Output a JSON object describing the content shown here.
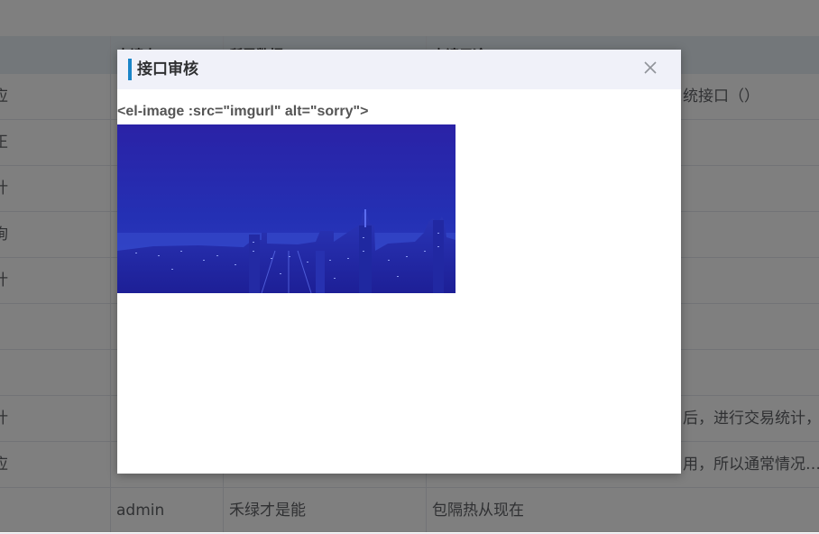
{
  "table": {
    "columns": [
      {
        "label": ""
      },
      {
        "label": "申请人"
      },
      {
        "label": "所需数据"
      },
      {
        "label": "申请用途"
      }
    ],
    "rows": [
      {
        "c0": "应",
        "c1": "",
        "c2": "",
        "c3": "…统接口（）"
      },
      {
        "c0": "正",
        "c1": "",
        "c2": "",
        "c3": ""
      },
      {
        "c0": "计",
        "c1": "",
        "c2": "",
        "c3": ""
      },
      {
        "c0": "询",
        "c1": "",
        "c2": "",
        "c3": ""
      },
      {
        "c0": "计",
        "c1": "",
        "c2": "",
        "c3": ""
      },
      {
        "c0": "",
        "c1": "",
        "c2": "",
        "c3": ""
      },
      {
        "c0": "",
        "c1": "",
        "c2": "",
        "c3": ""
      },
      {
        "c0": "计",
        "c1": "",
        "c2": "",
        "c3": "…后，进行交易统计，…"
      },
      {
        "c0": "应",
        "c1": "",
        "c2": "",
        "c3": "…用，所以通常情况…"
      },
      {
        "c0": "",
        "c1": "admin",
        "c2": "禾绿才是能",
        "c3": "包隔热从现在"
      }
    ]
  },
  "dialog": {
    "title": "接口审核",
    "close_icon": "close-icon",
    "code_text": "<el-image :src=\"imgurl\" alt=\"sorry\">",
    "image_description_icon": "city-night-skyline-image"
  },
  "colors": {
    "accent": "#1a85c8",
    "header_bg": "#f0f1f9",
    "image_tint": "#2a2fb0"
  }
}
